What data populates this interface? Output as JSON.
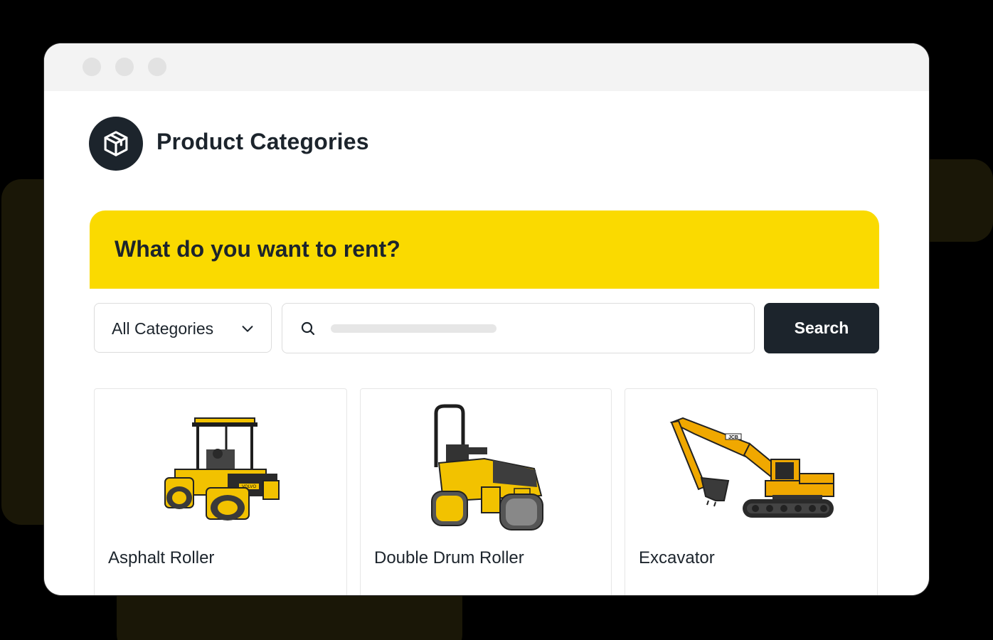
{
  "window": {
    "title_dots": [
      "close",
      "minimize",
      "maximize"
    ]
  },
  "header": {
    "icon": "package-box-icon",
    "title": "Product Categories"
  },
  "banner": {
    "text": "What do you want to rent?",
    "color": "#fada00"
  },
  "filters": {
    "category_select_value": "All Categories",
    "search_placeholder": "",
    "search_button_label": "Search"
  },
  "products": [
    {
      "name": "Asphalt Roller",
      "image": "asphalt-roller-image"
    },
    {
      "name": "Double Drum Roller",
      "image": "double-drum-roller-image"
    },
    {
      "name": "Excavator",
      "image": "excavator-image"
    }
  ],
  "colors": {
    "dark": "#1c242c",
    "accent": "#fada00",
    "background": "#000000"
  }
}
